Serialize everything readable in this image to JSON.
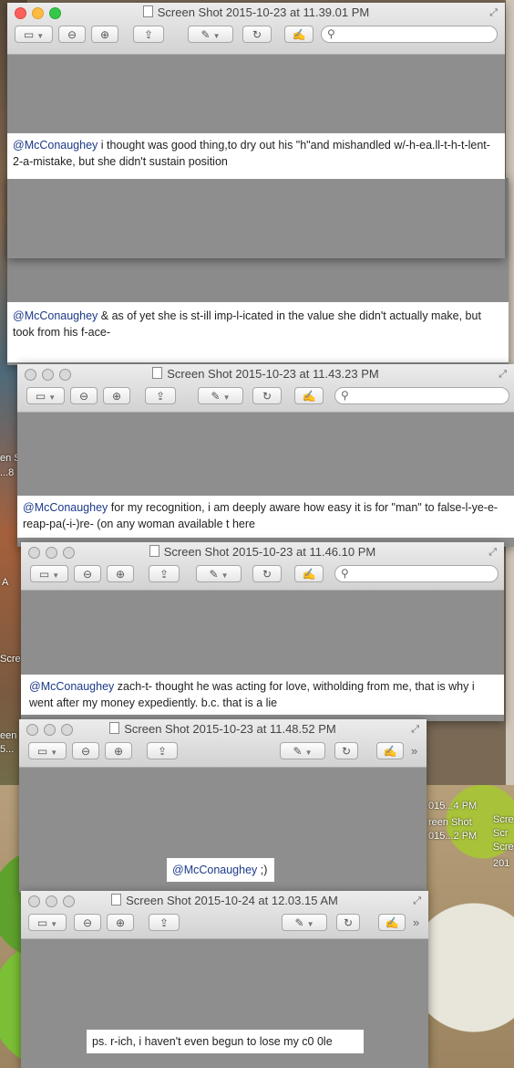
{
  "windows": [
    {
      "title": "Screen Shot 2015-10-23 at 11.39.01 PM",
      "tweet": {
        "mention": "@McConaughey",
        "text": " i thought was good thing,to dry out his \"h\"and mishandled w/-h-ea.ll-t-h-t-lent-2-a-mistake, but she didn't sustain position"
      }
    },
    {
      "title": "Screen Shot 2015-10-23 at 11.43.23 PM",
      "tweet": {
        "mention": "@McConaughey",
        "text": " for my recognition, i am deeply aware how easy it is for \"man\" to false-l-ye-e-reap-pa(-i-)re- (on any woman available t here"
      }
    },
    {
      "title": "Screen Shot 2015-10-23 at 11.46.10 PM",
      "tweet": {
        "mention": "@McConaughey",
        "text": " zach-t- thought he was acting for love, witholding from me, that is why i went after my money expediently. b.c. that is a lie"
      }
    },
    {
      "title": "Screen Shot 2015-10-23 at 11.48.52 PM",
      "tweet": {
        "mention": "@McConaughey",
        "text": " ;)"
      }
    },
    {
      "title": "Screen Shot 2015-10-24 at 12.03.15 AM",
      "tweet": {
        "mention": "",
        "text": "ps. r-ich, i haven't even begun to lose my c0 0le"
      }
    }
  ],
  "background_snippet": {
    "mention": "@McConaughey",
    "text": " & as of yet she is st-ill imp-l-icated in the value she didn't actually make, but took from his f-ace-"
  },
  "desktop_labels": [
    "en S",
    "...8",
    "A",
    "Scre",
    "een",
    "5...",
    "015...4 PM",
    "reen Shot",
    "015...2 PM",
    "Scre",
    "Scr",
    "Scre",
    "201"
  ],
  "toolbar": {
    "sidebar": "▭",
    "zoom_out": "⊖",
    "zoom_in": "⊕",
    "share": "⇪",
    "markup": "✎",
    "rotate": "↻",
    "annotate": "✍",
    "more": "»",
    "search_glyph": "⚲"
  },
  "colors": {
    "mention": "#1b3a8a",
    "content_bg": "#8e8e8e",
    "close": "#fc605c",
    "minimize": "#fdbc40",
    "zoom": "#34c84a"
  }
}
